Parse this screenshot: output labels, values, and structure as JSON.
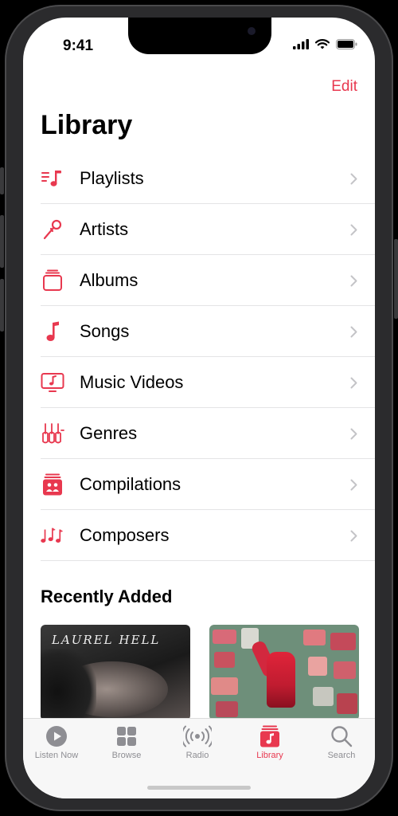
{
  "status_bar": {
    "time": "9:41"
  },
  "header": {
    "edit_label": "Edit",
    "title": "Library"
  },
  "library_items": [
    {
      "label": "Playlists",
      "icon": "playlists-icon"
    },
    {
      "label": "Artists",
      "icon": "microphone-icon"
    },
    {
      "label": "Albums",
      "icon": "albums-icon"
    },
    {
      "label": "Songs",
      "icon": "music-note-icon"
    },
    {
      "label": "Music Videos",
      "icon": "music-video-icon"
    },
    {
      "label": "Genres",
      "icon": "genres-icon"
    },
    {
      "label": "Compilations",
      "icon": "compilations-icon"
    },
    {
      "label": "Composers",
      "icon": "composers-icon"
    }
  ],
  "recently_added": {
    "title": "Recently Added",
    "albums": [
      {
        "cover_text": "LAUREL HELL"
      },
      {
        "cover_text": ""
      }
    ]
  },
  "tab_bar": {
    "tabs": [
      {
        "label": "Listen Now",
        "icon": "play-circle-icon",
        "active": false
      },
      {
        "label": "Browse",
        "icon": "grid-icon",
        "active": false
      },
      {
        "label": "Radio",
        "icon": "radio-icon",
        "active": false
      },
      {
        "label": "Library",
        "icon": "library-icon",
        "active": true
      },
      {
        "label": "Search",
        "icon": "search-icon",
        "active": false
      }
    ]
  },
  "colors": {
    "accent": "#e8384f",
    "inactive": "#8e8e93",
    "chevron": "#c4c4c7"
  }
}
